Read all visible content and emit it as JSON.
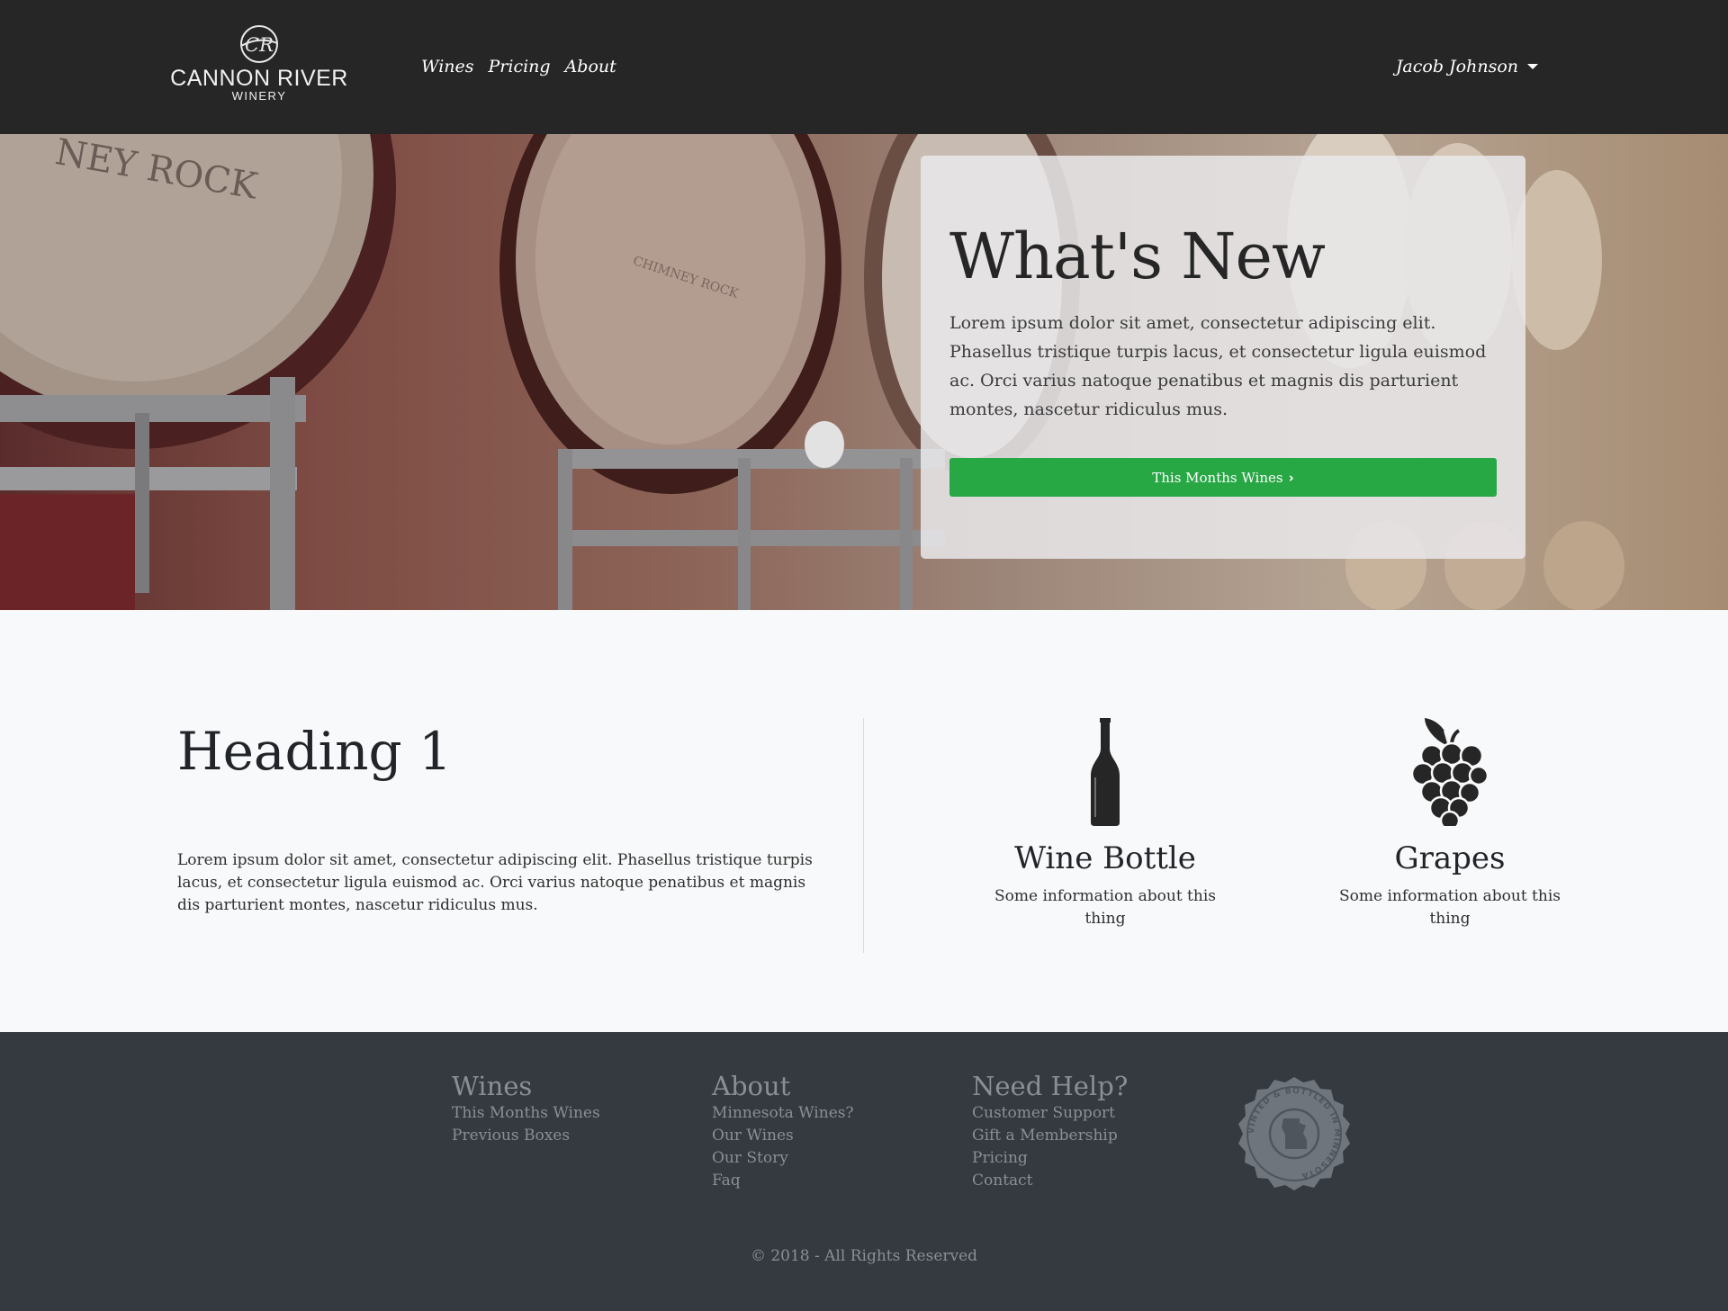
{
  "brand": {
    "monogram": "CR",
    "name": "CANNON RIVER",
    "subtitle": "WINERY"
  },
  "nav": {
    "links": [
      "Wines",
      "Pricing",
      "About"
    ],
    "user_name": "Jacob Johnson"
  },
  "hero": {
    "barrel_text_1": "NEY ROCK",
    "barrel_text_2": "CHIMNEY ROCK",
    "title": "What's New",
    "text": "Lorem ipsum dolor sit amet, consectetur adipiscing elit. Phasellus tristique turpis lacus, et consectetur ligula euismod ac. Orci varius natoque penatibus et magnis dis parturient montes, nascetur ridiculus mus.",
    "button_label": "This Months Wines",
    "button_color": "#28a745"
  },
  "main": {
    "heading": "Heading 1",
    "text": "Lorem ipsum dolor sit amet, consectetur adipiscing elit. Phasellus tristique turpis lacus, et consectetur ligula euismod ac. Orci varius natoque penatibus et magnis dis parturient montes, nascetur ridiculus mus.",
    "features": [
      {
        "icon": "wine-bottle-icon",
        "title": "Wine Bottle",
        "text": "Some information about this thing"
      },
      {
        "icon": "grapes-icon",
        "title": "Grapes",
        "text": "Some information about this thing"
      }
    ]
  },
  "footer": {
    "columns": [
      {
        "title": "Wines",
        "links": [
          "This Months Wines",
          "Previous Boxes"
        ]
      },
      {
        "title": "About",
        "links": [
          "Minnesota Wines?",
          "Our Wines",
          "Our Story",
          "Faq"
        ]
      },
      {
        "title": "Need Help?",
        "links": [
          "Customer Support",
          "Gift a Membership",
          "Pricing",
          "Contact"
        ]
      }
    ],
    "seal_text": "VINTED & BOTTLED IN MINNESOTA",
    "copyright": "© 2018 - All Rights Reserved"
  }
}
